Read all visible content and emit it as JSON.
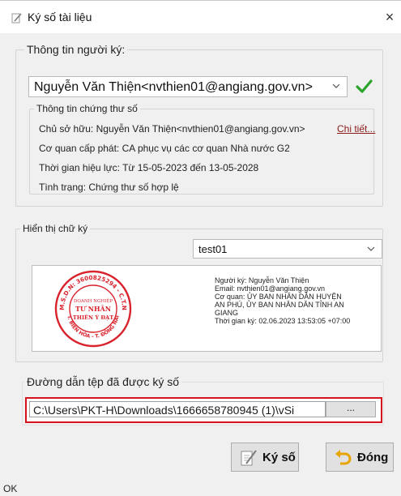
{
  "window": {
    "title": "Ký số tài liệu",
    "close_glyph": "×"
  },
  "signer": {
    "group_title": "Thông tin người ký:",
    "selected": "Nguyễn Văn Thiện<nvthien01@angiang.gov.vn>",
    "cert": {
      "title": "Thông tin chứng thư số",
      "owner": "Chủ sở hữu: Nguyễn Văn Thiện<nvthien01@angiang.gov.vn>",
      "details_link": "Chi tiết...",
      "issuer": "Cơ quan cấp phát: CA phục vụ các cơ quan Nhà nước G2",
      "validity": "Thời gian hiệu lực: Từ 15-05-2023 đến 13-05-2028",
      "status": "Tình trạng: Chứng thư số hợp lệ"
    }
  },
  "signature_display": {
    "group_title": "Hiển thị chữ ký",
    "template": "test01",
    "preview": {
      "line1": "Người ký: Nguyễn Văn Thiện",
      "line2": "Email: nvthien01@angiang.gov.vn",
      "line3": "Cơ quan: ỦY BAN NHÂN DÂN HUYỆN",
      "line4": "AN PHÚ, ỦY BAN NHÂN DÂN TỈNH AN",
      "line5": "GIANG",
      "line6": "Thời gian ký: 02.06.2023 13:53:05 +07:00"
    },
    "stamp": {
      "ring_text": "M.S.D.N: 3600825294 - C.T.N",
      "center_line1": "DOANH NGHIỆP",
      "center_line2": "TƯ NHÂN",
      "center_line3": "THIÊN Ý ĐẠT",
      "bottom_text": "T. BIÊN HÒA - T. ĐỒNG NAI"
    }
  },
  "output": {
    "label": "Đường dẫn tệp đã được ký số",
    "path": "C:\\Users\\PKT-H\\Downloads\\1666658780945 (1)\\vSi",
    "browse_label": "..."
  },
  "buttons": {
    "sign": "Ký số",
    "close": "Đóng"
  },
  "statusbar": {
    "text": "OK"
  },
  "colors": {
    "accent_red": "#d6131c",
    "check_green": "#2aa52a",
    "stamp_red": "#d9232d"
  }
}
